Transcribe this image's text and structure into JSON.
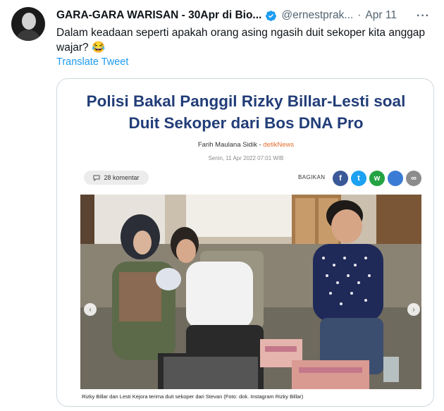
{
  "tweet": {
    "display_name": "GARA-GARA WARISAN - 30Apr di Bio...",
    "handle": "@ernestprak...",
    "separator": "·",
    "time": "Apr 11",
    "more": "···",
    "text": "Dalam keadaan seperti apakah orang asing ngasih duit sekoper kita anggap wajar? 😂",
    "translate": "Translate Tweet",
    "accent_color": "#1d9bf0"
  },
  "article": {
    "headline_line1": "Polisi Bakal Panggil Rizky Billar-Lesti soal",
    "headline_line2": "Duit Sekoper dari Bos DNA Pro",
    "author": "Farih Maulana Sidik",
    "byline_sep": " - ",
    "source": "detikNews",
    "date": "Senin, 11 Apr 2022 07:01 WIB",
    "comments": "28 komentar",
    "share_label": "BAGIKAN",
    "share_buttons": [
      {
        "icon": "facebook-icon",
        "glyph": "f",
        "color": "#3b5998"
      },
      {
        "icon": "twitter-icon",
        "glyph": "t",
        "color": "#1da1f2"
      },
      {
        "icon": "whatsapp-icon",
        "glyph": "w",
        "color": "#25a244"
      },
      {
        "icon": "generic-share-icon",
        "glyph": "",
        "color": "#3a7bd5"
      },
      {
        "icon": "link-icon",
        "glyph": "∞",
        "color": "#8c8c8c"
      }
    ],
    "caption": "Rizky Billar dan Lesti Kejora terima duit sekoper dari Stevan (Foto: dok. Instagram Rizky Billar)",
    "prev_arrow": "‹",
    "next_arrow": "›"
  }
}
